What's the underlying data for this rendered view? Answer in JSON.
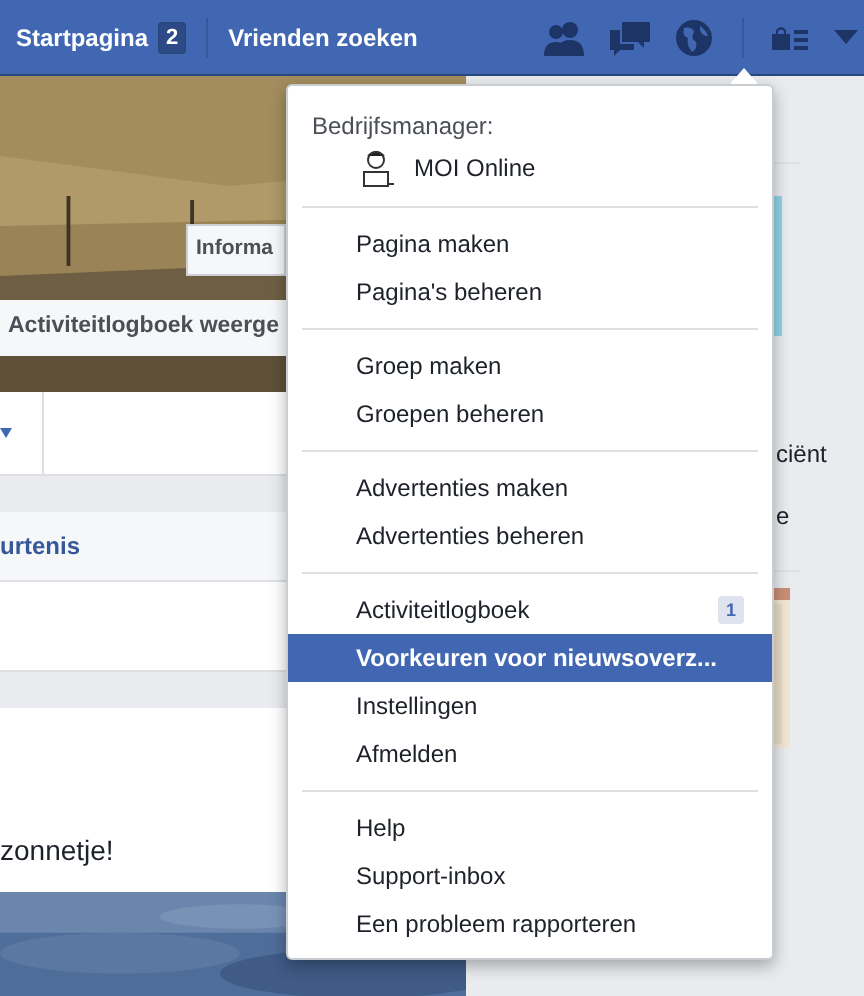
{
  "top_bar": {
    "links": [
      {
        "label": "Startpagina",
        "badge": "2"
      },
      {
        "label": "Vrienden zoeken"
      }
    ]
  },
  "cover": {
    "buttons": [
      "Informa",
      "Activiteitlogboek weerge"
    ]
  },
  "timeline": {
    "tab_link": "urtenis",
    "post_text": "zonnetje!"
  },
  "right_column": {
    "snippets": [
      "ciënt",
      "e"
    ]
  },
  "menu": {
    "header": "Bedrijfsmanager:",
    "account": "MOI Online",
    "sections": [
      [
        {
          "label": "Pagina maken",
          "selected": false
        },
        {
          "label": "Pagina's beheren",
          "selected": false
        }
      ],
      [
        {
          "label": "Groep maken",
          "selected": false
        },
        {
          "label": "Groepen beheren",
          "selected": false
        }
      ],
      [
        {
          "label": "Advertenties maken",
          "selected": false
        },
        {
          "label": "Advertenties beheren",
          "selected": false
        }
      ],
      [
        {
          "label": "Activiteitlogboek",
          "badge": "1",
          "selected": false
        },
        {
          "label": "Voorkeuren voor nieuwsoverz...",
          "selected": true
        },
        {
          "label": "Instellingen",
          "selected": false
        },
        {
          "label": "Afmelden",
          "selected": false
        }
      ],
      [
        {
          "label": "Help",
          "selected": false
        },
        {
          "label": "Support-inbox",
          "selected": false
        },
        {
          "label": "Een probleem rapporteren",
          "selected": false
        }
      ]
    ]
  }
}
